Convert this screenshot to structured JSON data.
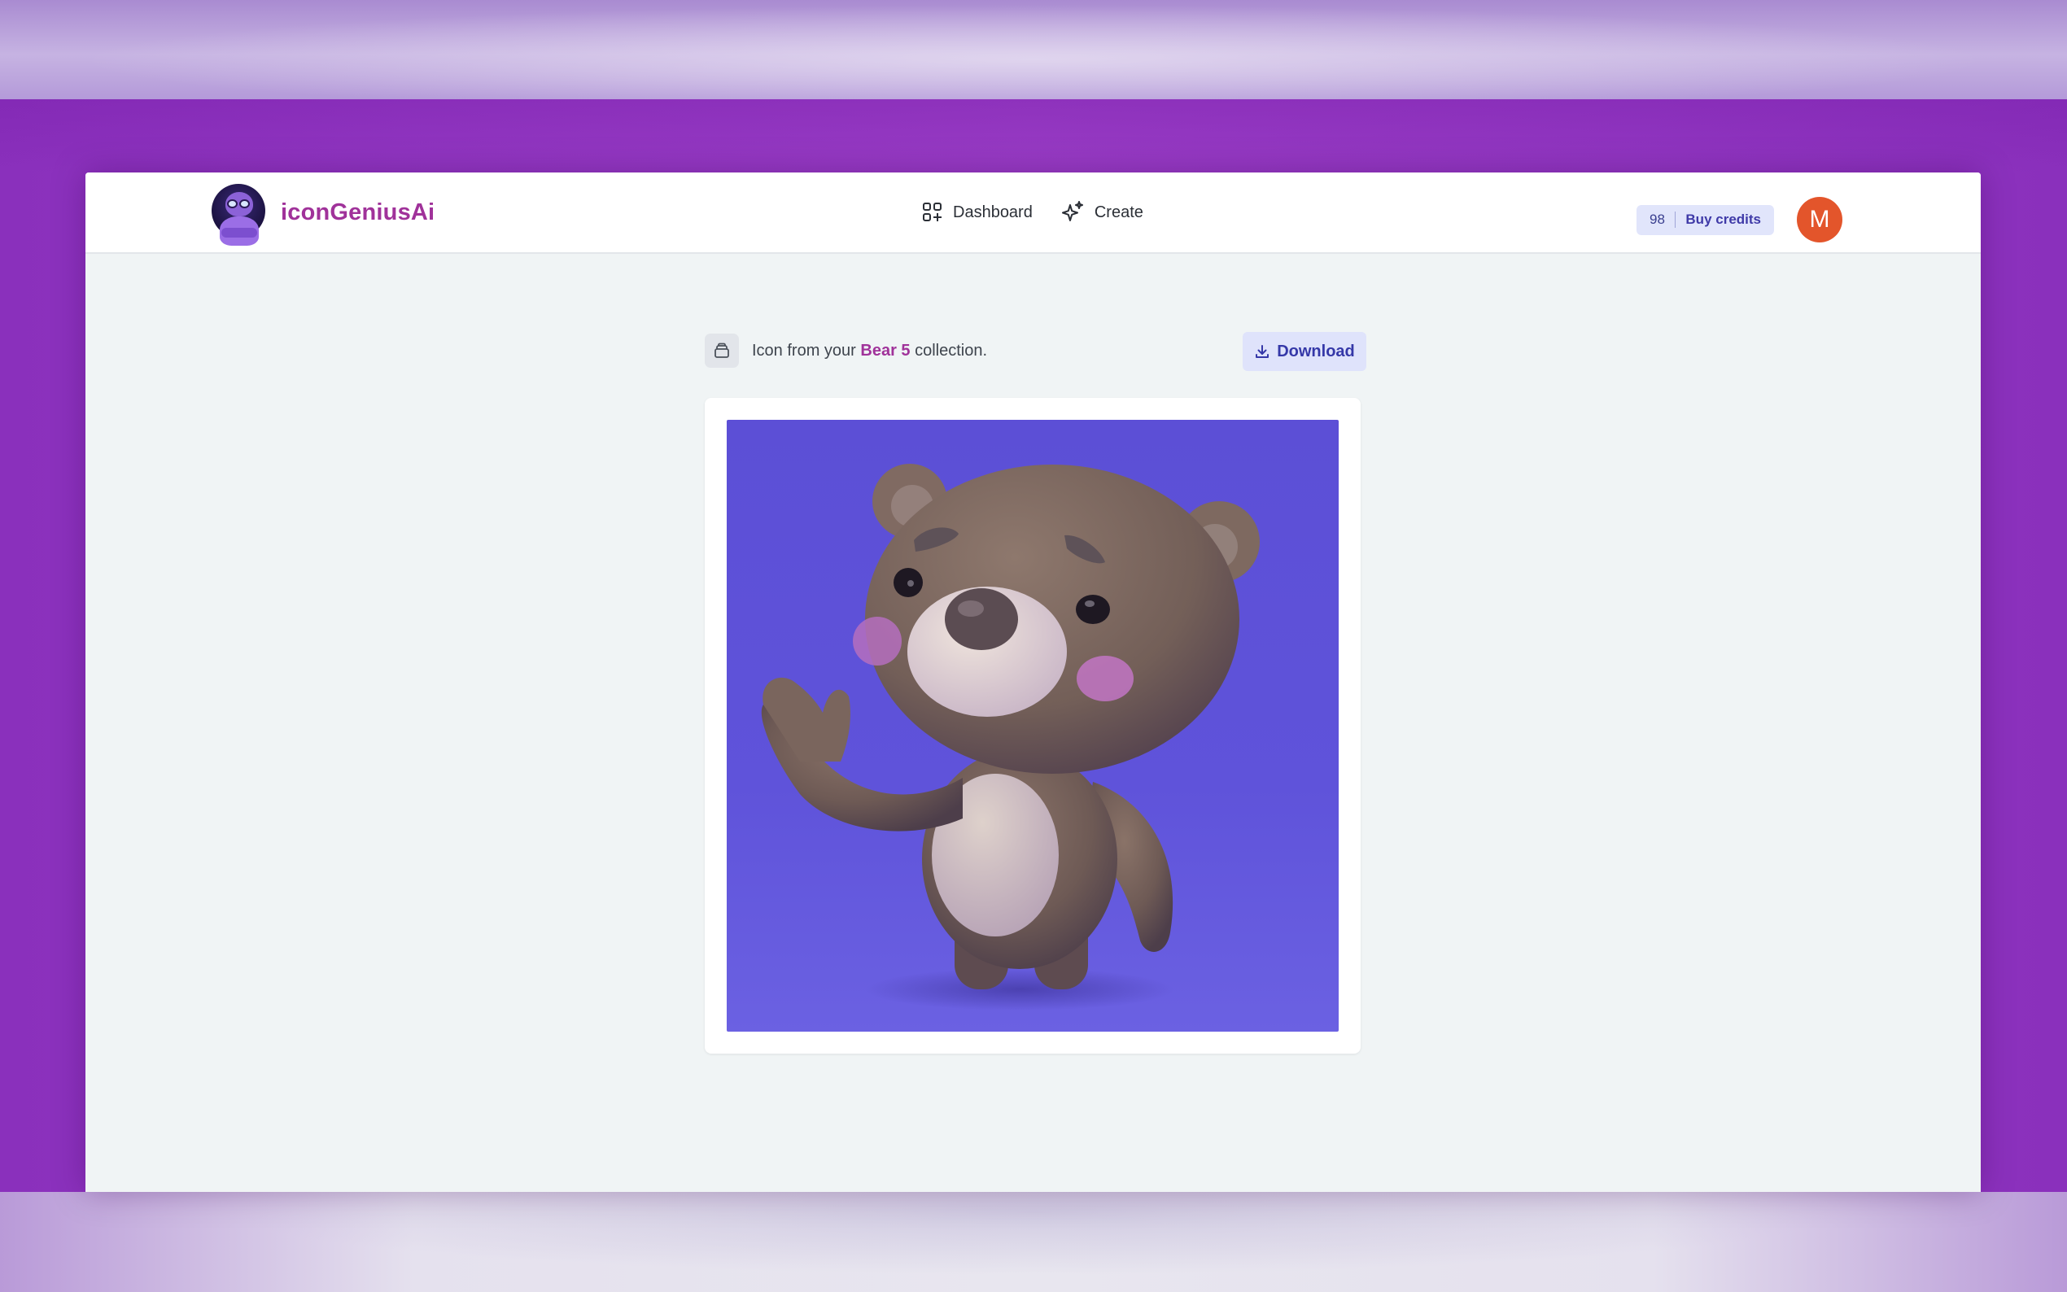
{
  "app": {
    "brand_name": "iconGeniusAi",
    "brand_color": "#a0329a"
  },
  "nav": {
    "items": [
      {
        "label": "Dashboard",
        "icon": "dashboard-grid-icon"
      },
      {
        "label": "Create",
        "icon": "sparkles-icon"
      }
    ]
  },
  "account": {
    "credits": "98",
    "buy_label": "Buy credits",
    "avatar_initial": "M",
    "avatar_color": "#e3552b"
  },
  "icon_view": {
    "prefix": "Icon from your ",
    "collection_name": "Bear 5",
    "suffix": " collection.",
    "download_label": "Download",
    "image_subject": "3D brown teddy bear waving on purple background"
  }
}
